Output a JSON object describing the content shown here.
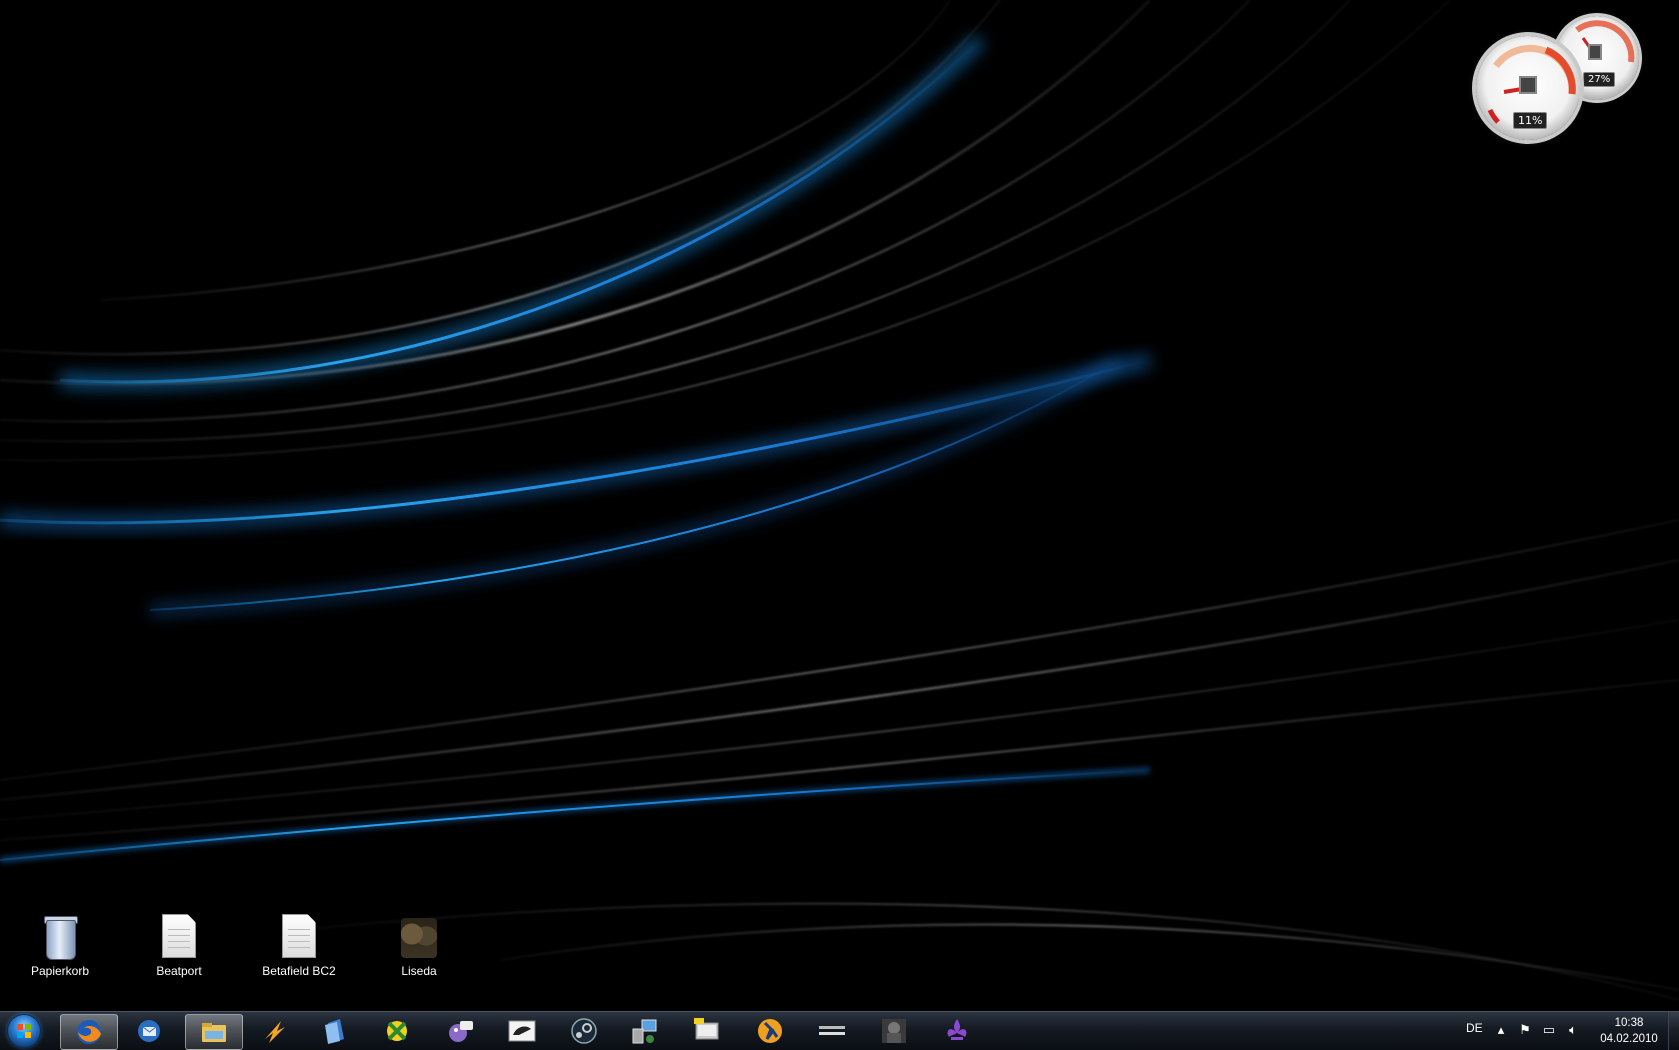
{
  "gadgets": {
    "cpu_meter": {
      "cpu_percent": "11%",
      "memory_percent": "27%"
    }
  },
  "desktop_icons": [
    {
      "label": "Papierkorb",
      "icon": "recycle-bin-icon"
    },
    {
      "label": "Beatport",
      "icon": "document-icon"
    },
    {
      "label": "Betafield BC2",
      "icon": "document-icon"
    },
    {
      "label": "Liseda",
      "icon": "game-shortcut-icon"
    }
  ],
  "taskbar": {
    "start_icon": "windows-orb-icon",
    "pinned": [
      {
        "name": "firefox",
        "icon": "firefox-icon",
        "active": true
      },
      {
        "name": "thunderbird",
        "icon": "thunderbird-icon",
        "active": false
      },
      {
        "name": "explorer",
        "icon": "folder-icon",
        "active": true
      },
      {
        "name": "winamp",
        "icon": "winamp-icon",
        "active": false
      },
      {
        "name": "documents",
        "icon": "blue-document-icon",
        "active": false
      },
      {
        "name": "xfire",
        "icon": "xfire-icon",
        "active": false
      },
      {
        "name": "pidgin",
        "icon": "pidgin-icon",
        "active": false
      },
      {
        "name": "app",
        "icon": "app-window-icon",
        "active": false
      },
      {
        "name": "steam",
        "icon": "steam-icon",
        "active": false
      },
      {
        "name": "network",
        "icon": "network-computer-icon",
        "active": false
      },
      {
        "name": "monitor",
        "icon": "monitor-icon",
        "active": false
      },
      {
        "name": "counter-strike",
        "icon": "counter-strike-icon",
        "active": false
      },
      {
        "name": "battlefield-2142",
        "icon": "battlefield-icon",
        "active": false
      },
      {
        "name": "soldier-game",
        "icon": "soldier-game-icon",
        "active": false
      },
      {
        "name": "saints-row",
        "icon": "fleur-de-lis-icon",
        "active": false
      }
    ],
    "tray": {
      "language": "DE",
      "time": "10:38",
      "date": "04.02.2010"
    }
  }
}
